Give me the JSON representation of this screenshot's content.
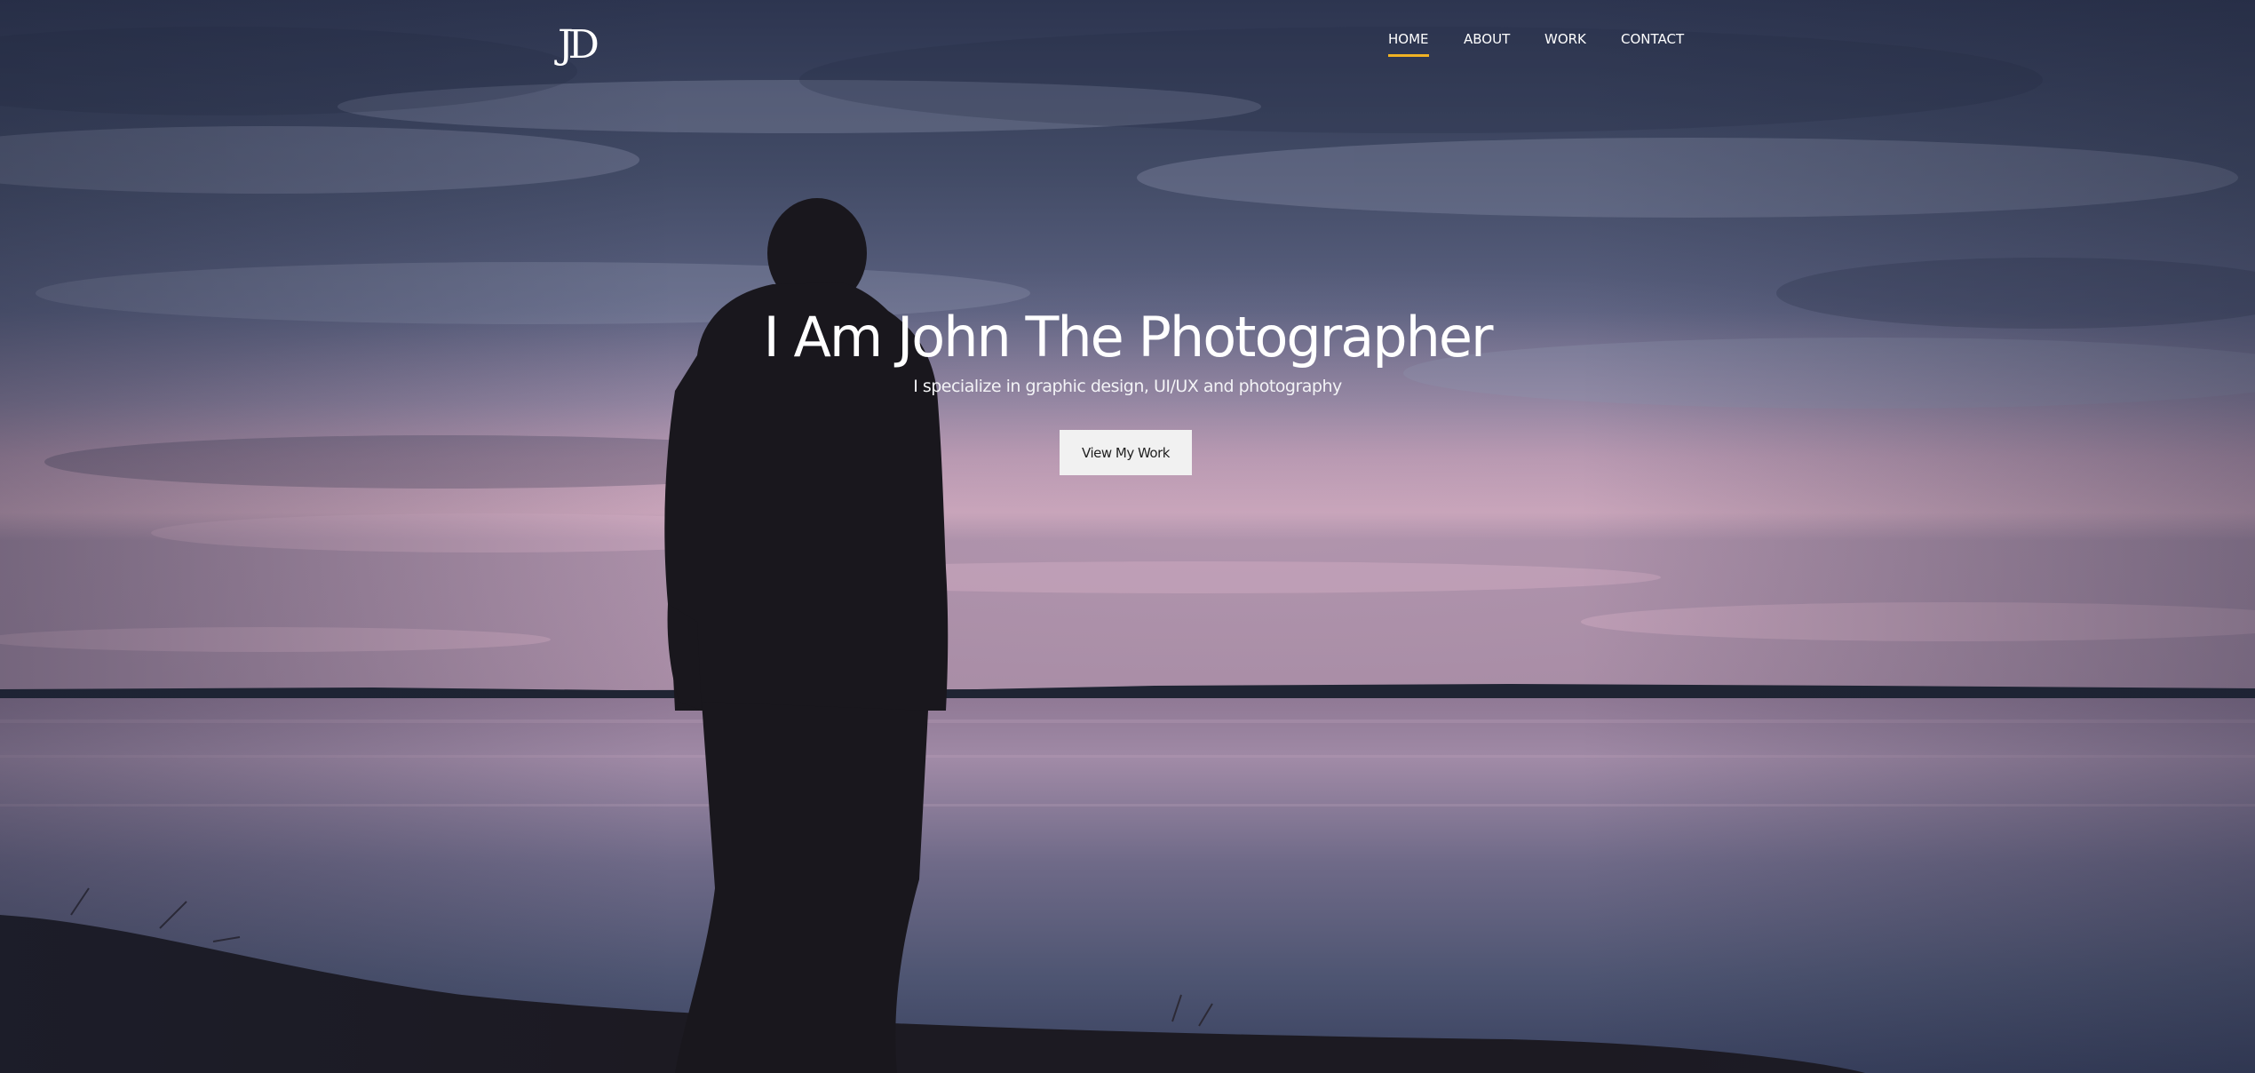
{
  "header": {
    "logo_text": "JD",
    "nav": [
      {
        "label": "HOME",
        "active": true
      },
      {
        "label": "ABOUT",
        "active": false
      },
      {
        "label": "WORK",
        "active": false
      },
      {
        "label": "CONTACT",
        "active": false
      }
    ],
    "active_underline_color": "#f0b324"
  },
  "hero": {
    "title": "I Am John The Photographer",
    "subtitle": "I specialize in graphic design, UI/UX and photography",
    "cta_label": "View My Work",
    "background": "photo: silhouette of a man in a hooded jacket standing at a lakeshore at dusk under a cloudy blue-purple sky"
  }
}
